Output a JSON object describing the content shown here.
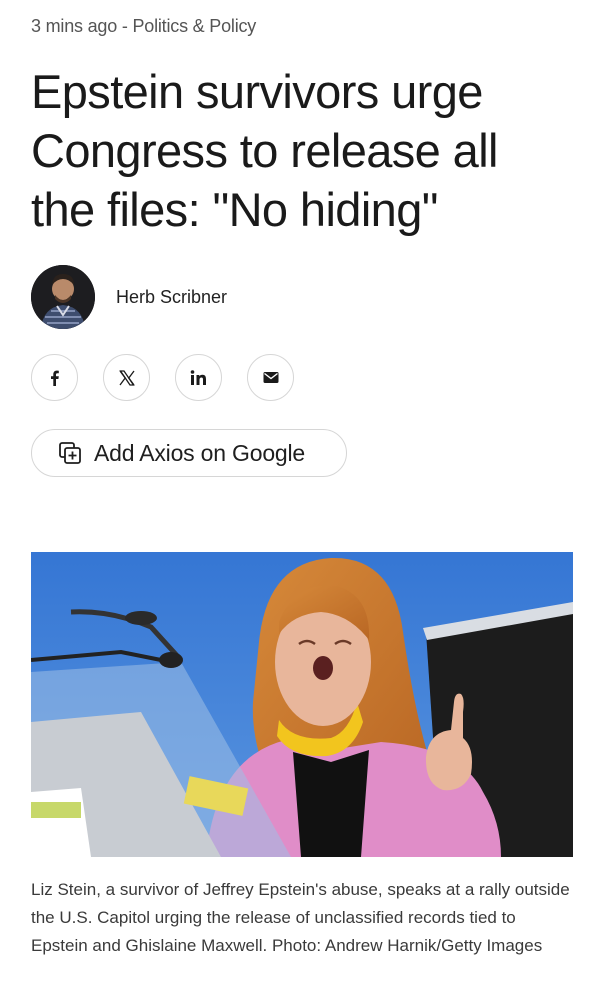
{
  "article": {
    "timestamp": "3 mins ago",
    "separator": " - ",
    "category": "Politics & Policy",
    "headline": "Epstein survivors urge Congress to release all the files: \"No hiding\"",
    "author": {
      "name": "Herb Scribner"
    },
    "share": [
      {
        "network": "facebook",
        "icon": "facebook-icon"
      },
      {
        "network": "x",
        "icon": "x-icon"
      },
      {
        "network": "linkedin",
        "icon": "linkedin-icon"
      },
      {
        "network": "email",
        "icon": "mail-icon"
      }
    ],
    "add_source_label": "Add Axios on Google",
    "photo": {
      "caption": "Liz Stein, a survivor of Jeffrey Epstein's abuse, speaks at a rally outside the U.S. Capitol urging the release of unclassified records tied to Epstein and Ghislaine Maxwell. Photo: Andrew Harnik/Getty Images"
    }
  },
  "colors": {
    "text": "#1a1a1a",
    "meta": "#555555",
    "border": "#d6d6d6",
    "sky": "#3f7fd6"
  }
}
